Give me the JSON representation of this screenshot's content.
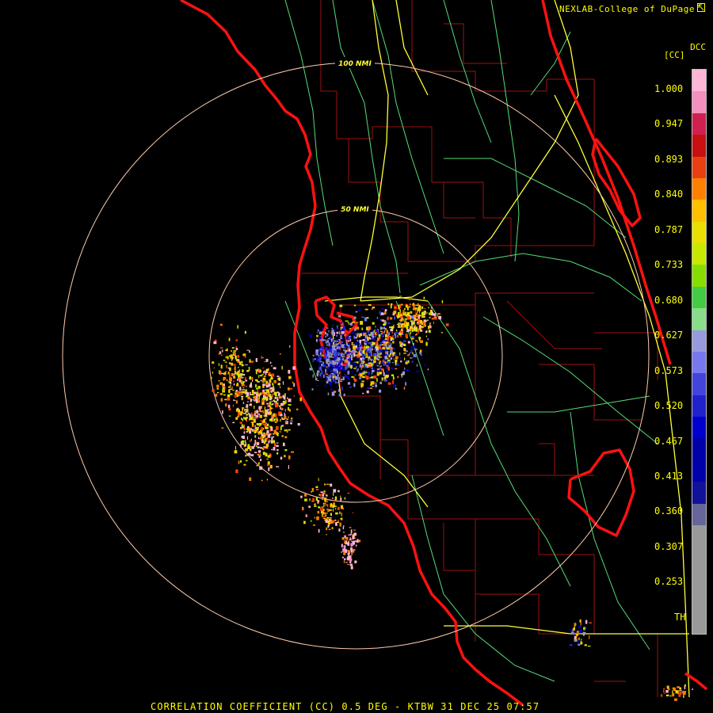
{
  "header": {
    "credit": "NEXLAB-College of DuPage",
    "credit_icon": "cursor-arrow-icon"
  },
  "map": {
    "radar_site": "KTBW",
    "range_rings": [
      "50 NMI",
      "100 NMI"
    ],
    "colors": {
      "coastline": "#ff1111",
      "county_lines": "#a01010",
      "highways": "#ffff33",
      "roads": "#55dd77",
      "range_rings": "#ffccaa"
    }
  },
  "legend": {
    "code": "DCC",
    "unit": "[CC]",
    "ticks": [
      "1.000",
      "0.947",
      "0.893",
      "0.840",
      "0.787",
      "0.733",
      "0.680",
      "0.627",
      "0.573",
      "0.520",
      "0.467",
      "0.413",
      "0.360",
      "0.307",
      "0.253",
      "TH"
    ],
    "colors": [
      "#ffb6d5",
      "#f48fbf",
      "#d02050",
      "#c81010",
      "#e84010",
      "#ff8000",
      "#ffc000",
      "#e8e000",
      "#c8e800",
      "#88dd00",
      "#44cc44",
      "#88dd88",
      "#9999dd",
      "#7777ee",
      "#4444dd",
      "#2222cc",
      "#0000cc",
      "#0000a8",
      "#0000aa",
      "#111199",
      "#666699",
      "#999999",
      "#999999",
      "#999999",
      "#999999",
      "#999999"
    ]
  },
  "footer": {
    "caption": "CORRELATION COEFFICIENT (CC) 0.5 DEG - KTBW 31 DEC 25 07:57"
  }
}
